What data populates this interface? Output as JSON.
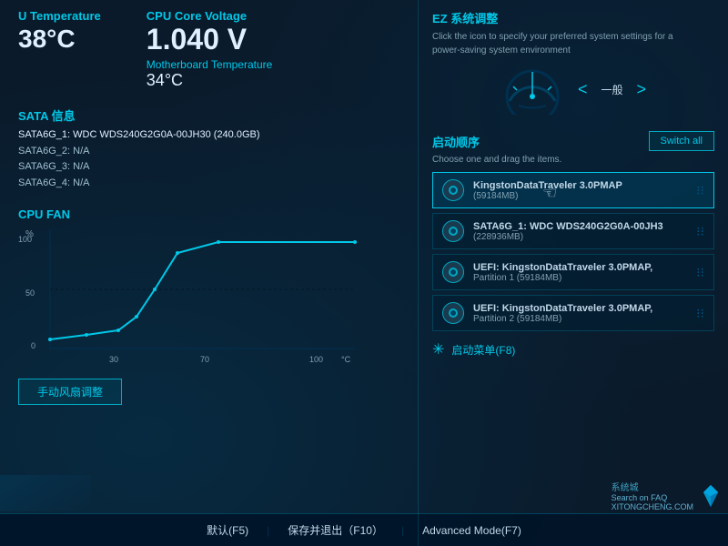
{
  "left": {
    "cpu_temp_label": "U Temperature",
    "cpu_temp_value": "38°C",
    "cpu_core_voltage_label": "CPU Core Voltage",
    "cpu_core_voltage_value": "1.040 V",
    "mb_temp_label": "Motherboard Temperature",
    "mb_temp_value": "34°C",
    "sata_title": "SATA 信息",
    "sata_items": [
      {
        "label": "SATA6G_1:",
        "value": "WDC WDS240G2G0A-00JH30 (240.0GB)",
        "highlight": true
      },
      {
        "label": "SATA6G_2:",
        "value": "N/A",
        "highlight": false
      },
      {
        "label": "SATA6G_3:",
        "value": "N/A",
        "highlight": false
      },
      {
        "label": "SATA6G_4:",
        "value": "N/A",
        "highlight": false
      }
    ],
    "fan_title": "CPU FAN",
    "fan_percent_label": "%",
    "fan_celsius_label": "°C",
    "fan_y_labels": [
      "100",
      "50",
      "0"
    ],
    "fan_x_labels": [
      "30",
      "70",
      "100"
    ],
    "fan_button": "手动风扇调整"
  },
  "right": {
    "ez_title": "EZ 系统调整",
    "ez_desc": "Click the icon to specify your preferred system settings for a power-saving system environment",
    "gauge_label": "一般",
    "gauge_prev": "<",
    "gauge_next": ">",
    "boot_title": "启动顺序",
    "boot_subtitle": "Choose one and drag the items.",
    "switch_all_label": "Switch all",
    "boot_items": [
      {
        "name": "KingstonDataTraveler 3.0PMAP",
        "size": "(59184MB)",
        "active": true
      },
      {
        "name": "SATA6G_1: WDC WDS240G2G0A-00JH3",
        "size": "(228936MB)",
        "active": false
      },
      {
        "name": "UEFI: KingstonDataTraveler 3.0PMAP,\nPartition 1 (59184MB)",
        "size": "",
        "active": false
      },
      {
        "name": "UEFI: KingstonDataTraveler 3.0PMAP,\nPartition 2 (59184MB)",
        "size": "",
        "active": false
      }
    ],
    "boot_menu_label": "启动菜单(F8)"
  },
  "bottom": {
    "default_label": "默认(F5)",
    "save_exit_label": "保存并退出（F10）",
    "advanced_label": "Advanced Mode(F7)"
  },
  "watermark": {
    "site_name": "系统城",
    "search_label": "Search on FAQ",
    "site_url": "XITONGCHENG.COM"
  }
}
